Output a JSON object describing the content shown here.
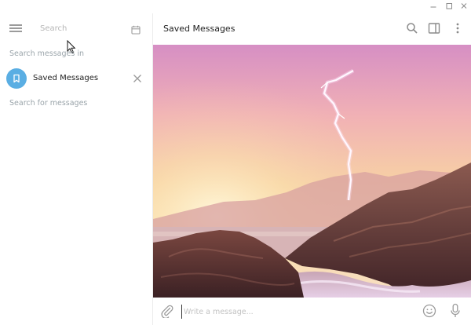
{
  "window": {
    "controls": {
      "minimize_icon": "minimize-icon",
      "maximize_icon": "maximize-icon",
      "close_icon": "close-icon"
    }
  },
  "sidebar": {
    "menu_icon": "hamburger-menu-icon",
    "search_placeholder": "Search",
    "calendar_icon": "calendar-icon",
    "search_in_label": "Search messages in",
    "chat": {
      "name": "Saved Messages",
      "avatar_icon": "bookmark-icon",
      "avatar_color": "#5aaee3"
    },
    "search_for_label": "Search for messages"
  },
  "chat": {
    "title": "Saved Messages",
    "header_icons": [
      "search-icon",
      "sidebar-toggle-icon",
      "more-vertical-icon"
    ],
    "composer": {
      "placeholder": "Write a message...",
      "icons": [
        "paperclip-icon",
        "emoji-icon",
        "microphone-icon"
      ]
    }
  },
  "colors": {
    "accent": "#5aaee3",
    "muted_text": "#9aa4aa",
    "icon": "#9b9b9b"
  }
}
